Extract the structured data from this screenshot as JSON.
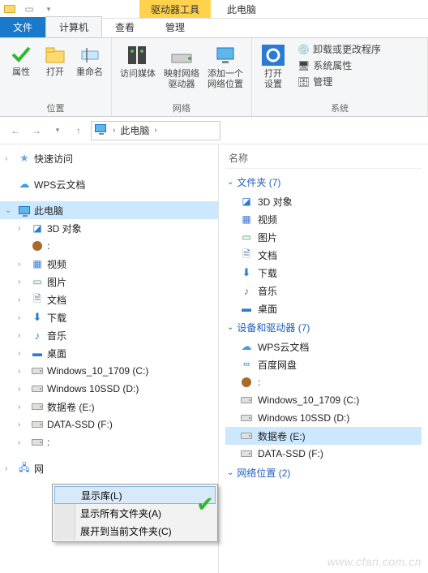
{
  "titlebar": {
    "contextual_tab": "驱动器工具",
    "title": "此电脑"
  },
  "tabs": {
    "file": "文件",
    "computer": "计算机",
    "view": "查看",
    "manage": "管理"
  },
  "ribbon": {
    "group_location": {
      "label": "位置",
      "properties": "属性",
      "open": "打开",
      "rename": "重命名"
    },
    "group_network": {
      "label": "网络",
      "access_media": "访问媒体",
      "map_drive": "映射网络\n驱动器",
      "add_location": "添加一个\n网络位置"
    },
    "group_system": {
      "label": "系统",
      "open_settings": "打开\n设置",
      "uninstall": "卸载或更改程序",
      "system_props": "系统属性",
      "manage": "管理"
    }
  },
  "breadcrumb": {
    "root": "此电脑"
  },
  "tree": {
    "quick_access": "快速访问",
    "wps_cloud": "WPS云文档",
    "this_pc": "此电脑",
    "items": {
      "objects3d": "3D 对象",
      "unknown": ":",
      "videos": "视频",
      "pictures": "图片",
      "documents": "文档",
      "downloads": "下载",
      "music": "音乐",
      "desktop": "桌面",
      "win10_1709": "Windows_10_1709 (C:)",
      "win10ssd": "Windows 10SSD (D:)",
      "data_e": "数据卷 (E:)",
      "data_ssd_f": "DATA-SSD (F:)",
      "blank": ":",
      "network_prefix": "网"
    }
  },
  "list": {
    "header_name": "名称",
    "group_folders": "文件夹 (7)",
    "group_drives": "设备和驱动器 (7)",
    "group_network": "网络位置 (2)",
    "folders": {
      "objects3d": "3D 对象",
      "videos": "视频",
      "pictures": "图片",
      "documents": "文档",
      "downloads": "下载",
      "music": "音乐",
      "desktop": "桌面"
    },
    "drives": {
      "wps": "WPS云文档",
      "baidu": "百度网盘",
      "nut": ":",
      "win10_1709": "Windows_10_1709 (C:)",
      "win10ssd": "Windows 10SSD (D:)",
      "data_e": "数据卷 (E:)",
      "data_ssd_f": "DATA-SSD (F:)"
    }
  },
  "context_menu": {
    "show_library": "显示库(L)",
    "show_all_folders": "显示所有文件夹(A)",
    "expand_current": "展开到当前文件夹(C)"
  },
  "watermark": "www.cfan.com.cn"
}
